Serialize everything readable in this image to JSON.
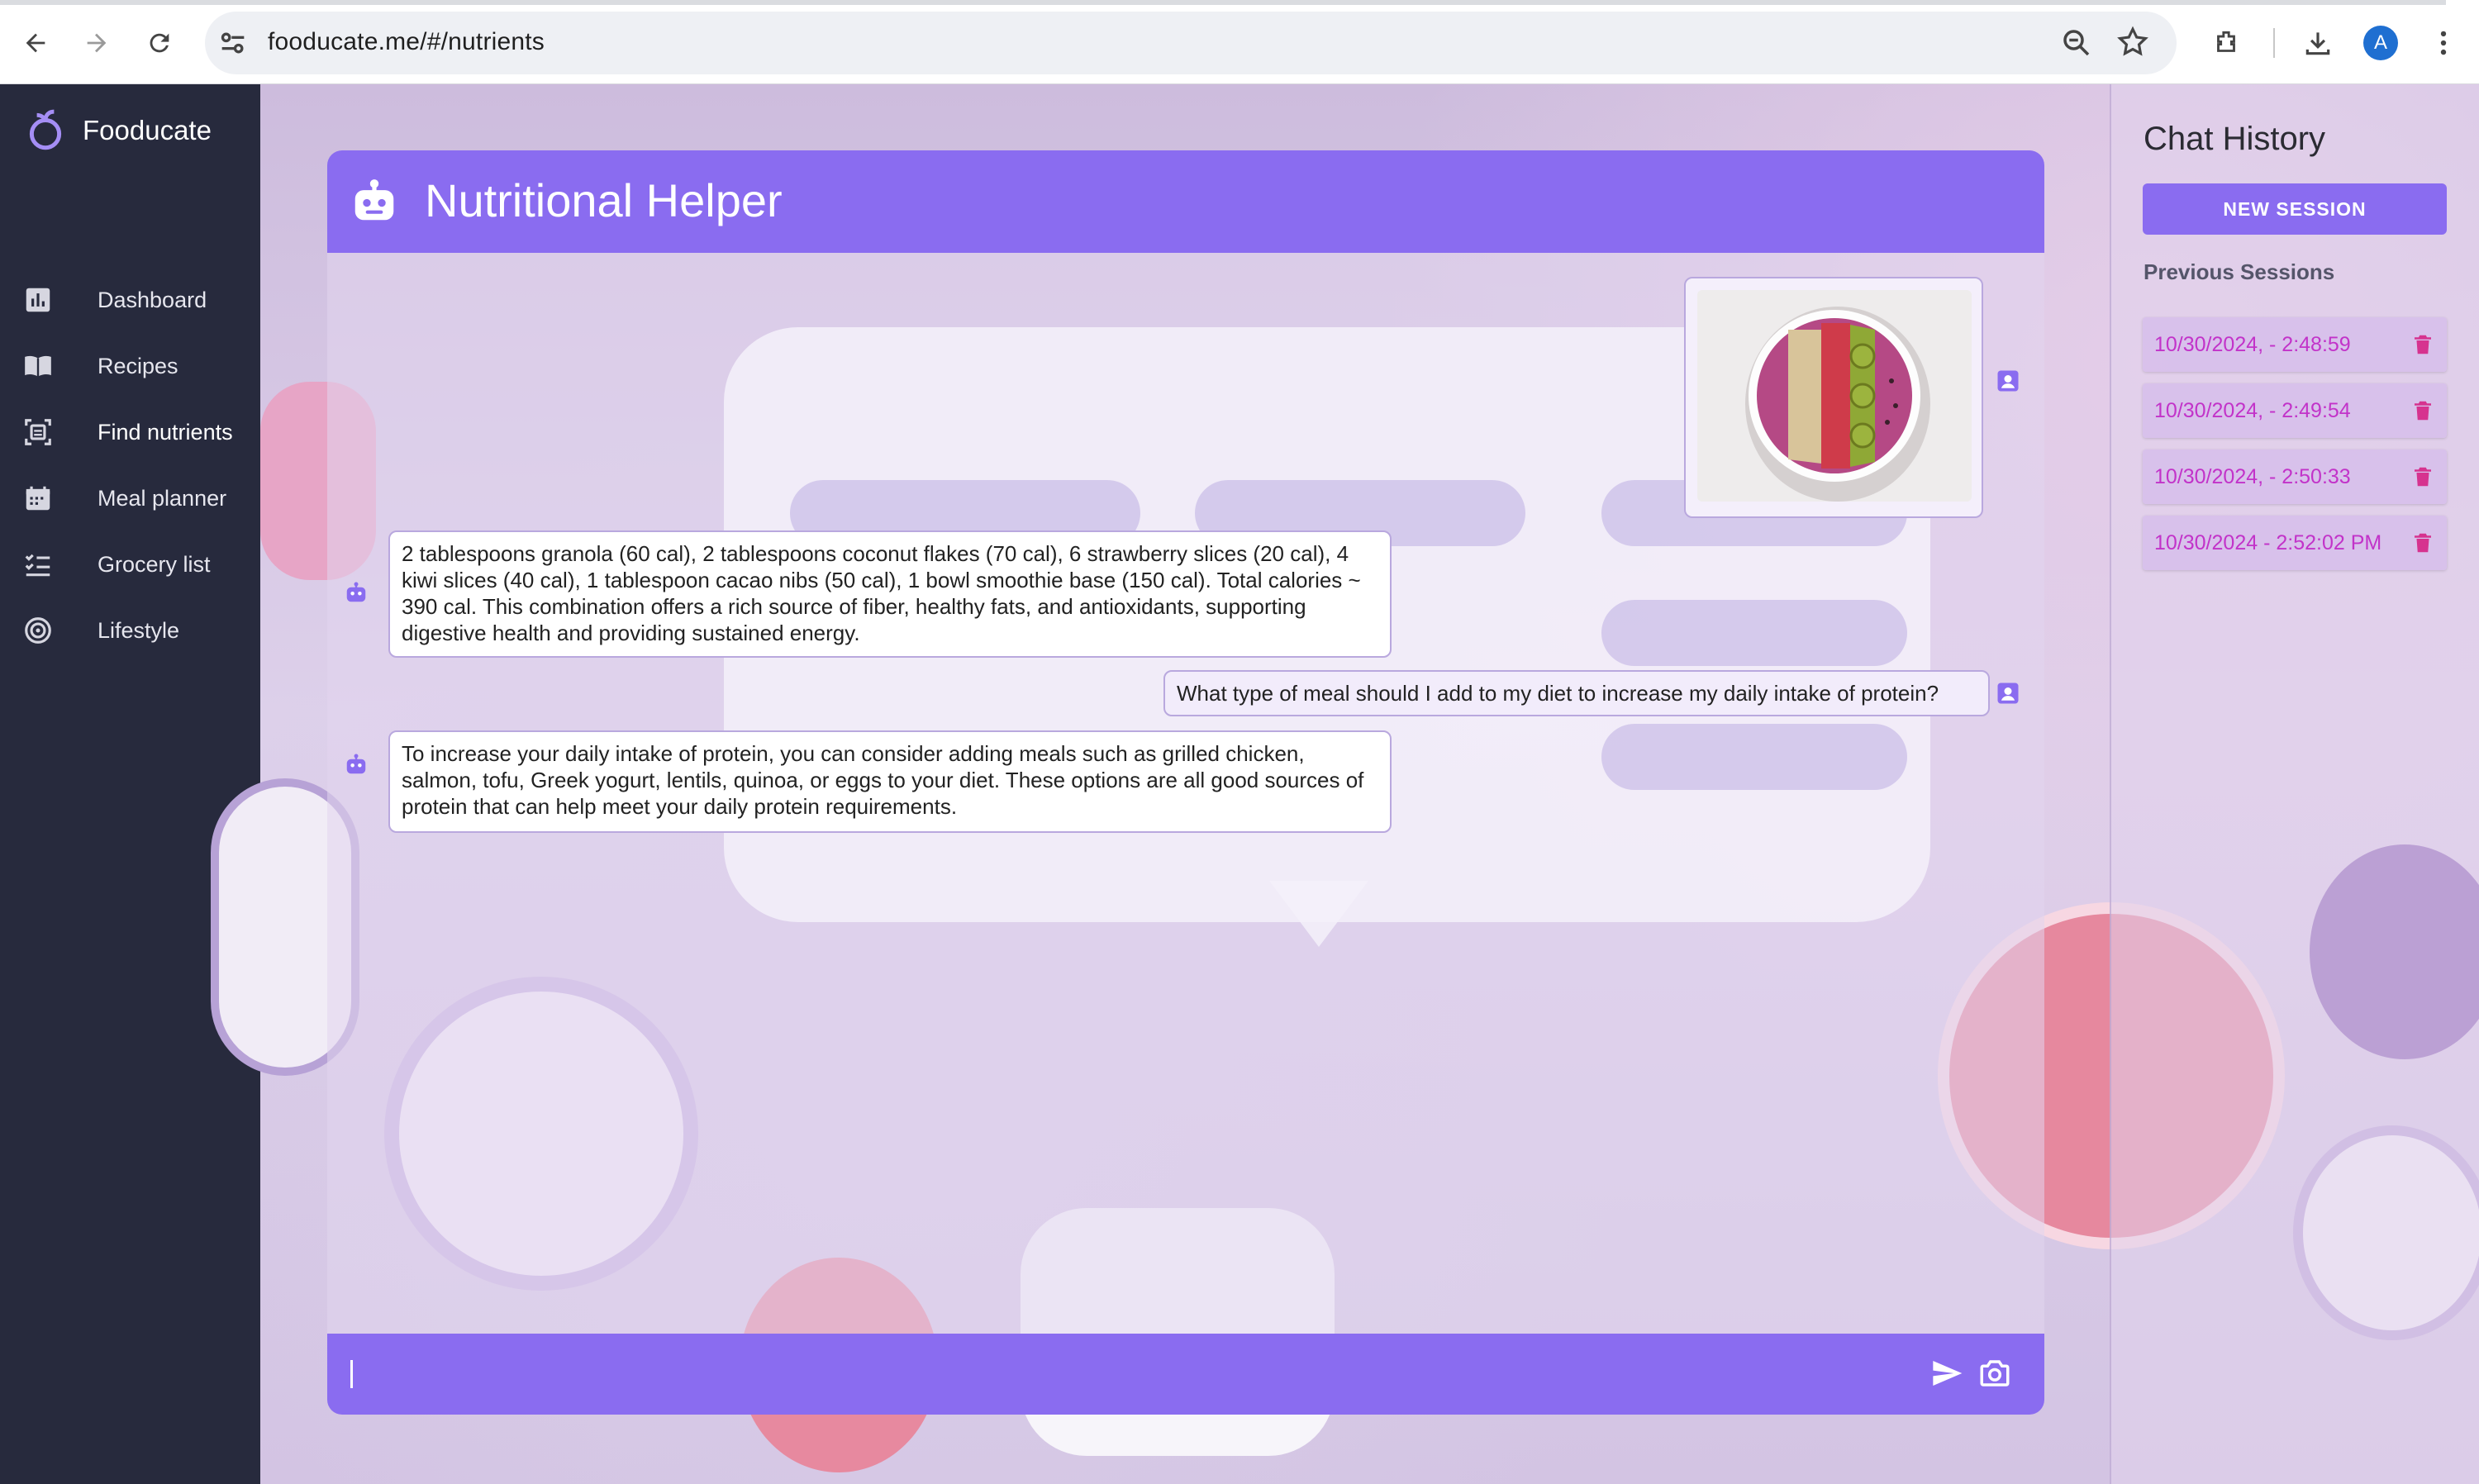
{
  "browser": {
    "url": "fooducate.me/#/nutrients",
    "avatar_letter": "A"
  },
  "app": {
    "brand": "Fooducate",
    "accent_color": "#8a6cf0",
    "sidebar_color": "#272a3d"
  },
  "sidebar": {
    "items": [
      {
        "label": "Dashboard",
        "icon": "bar-chart-icon"
      },
      {
        "label": "Recipes",
        "icon": "book-icon"
      },
      {
        "label": "Find nutrients",
        "icon": "scan-icon"
      },
      {
        "label": "Meal planner",
        "icon": "calendar-icon"
      },
      {
        "label": "Grocery list",
        "icon": "checklist-icon"
      },
      {
        "label": "Lifestyle",
        "icon": "target-icon"
      }
    ],
    "active_index": 2
  },
  "chat": {
    "title": "Nutritional Helper",
    "messages": [
      {
        "role": "user",
        "type": "image",
        "alt": "smoothie bowl photo"
      },
      {
        "role": "bot",
        "text": "2 tablespoons granola (60 cal), 2 tablespoons coconut flakes (70 cal), 6 strawberry slices (20 cal), 4 kiwi slices (40 cal), 1 tablespoon cacao nibs (50 cal), 1 bowl smoothie base (150 cal). Total calories ~ 390 cal. This combination offers a rich source of fiber, healthy fats, and antioxidants, supporting digestive health and providing sustained energy."
      },
      {
        "role": "user",
        "text": "What type of meal should I add to my diet to increase my daily intake of protein?"
      },
      {
        "role": "bot",
        "text": "To increase your daily intake of protein, you can consider adding meals such as grilled chicken, salmon, tofu, Greek yogurt, lentils, quinoa, or eggs to your diet. These options are all good sources of protein that can help meet your daily protein requirements."
      }
    ],
    "input": {
      "value": "",
      "placeholder": ""
    }
  },
  "history": {
    "title": "Chat History",
    "new_session_label": "NEW SESSION",
    "previous_label": "Previous Sessions",
    "sessions": [
      {
        "label": "10/30/2024, - 2:48:59"
      },
      {
        "label": "10/30/2024, - 2:49:54"
      },
      {
        "label": "10/30/2024, - 2:50:33"
      },
      {
        "label": "10/30/2024 - 2:52:02 PM"
      }
    ]
  }
}
